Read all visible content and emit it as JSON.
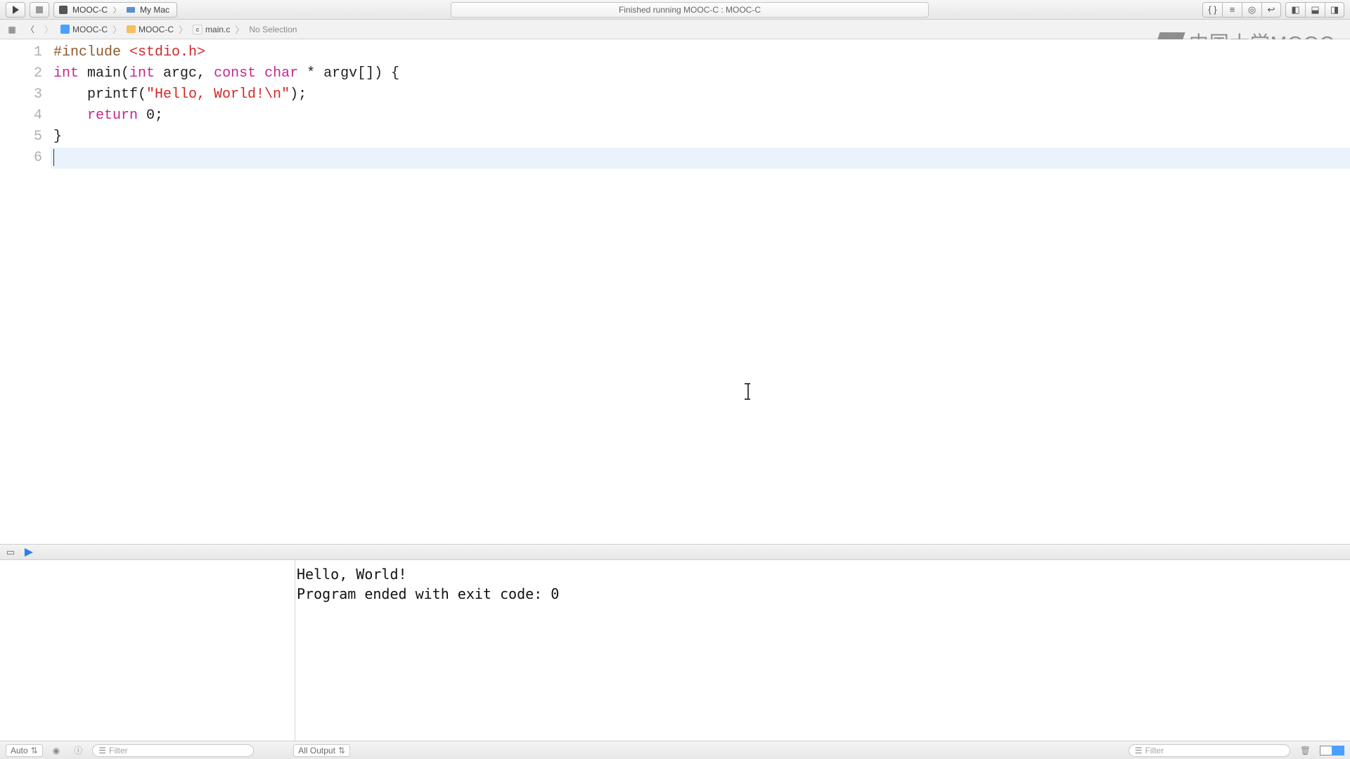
{
  "toolbar": {
    "scheme_project": "MOOC-C",
    "scheme_device": "My Mac",
    "status_text": "Finished running MOOC-C : MOOC-C"
  },
  "jumpbar": {
    "project": "MOOC-C",
    "folder": "MOOC-C",
    "file": "main.c",
    "selection": "No Selection"
  },
  "watermark": {
    "text": "中国大学MOOC"
  },
  "code": {
    "line_numbers": [
      "1",
      "2",
      "3",
      "4",
      "5",
      "6"
    ],
    "l1_a": "#include ",
    "l1_b": "<stdio.h>",
    "l2_a": "int",
    "l2_b": " main(",
    "l2_c": "int",
    "l2_d": " argc, ",
    "l2_e": "const",
    "l2_f": " ",
    "l2_g": "char",
    "l2_h": " * argv[]) {",
    "l3_a": "    printf(",
    "l3_b": "\"Hello, World!\\n\"",
    "l3_c": ");",
    "l4_a": "    ",
    "l4_b": "return",
    "l4_c": " 0;",
    "l5": "}",
    "l6": ""
  },
  "console": {
    "line1": "Hello, World!",
    "line2": "Program ended with exit code: 0"
  },
  "bottom": {
    "auto_label": "Auto",
    "filter_placeholder": "Filter",
    "output_scope": "All Output",
    "filter_placeholder2": "Filter"
  }
}
